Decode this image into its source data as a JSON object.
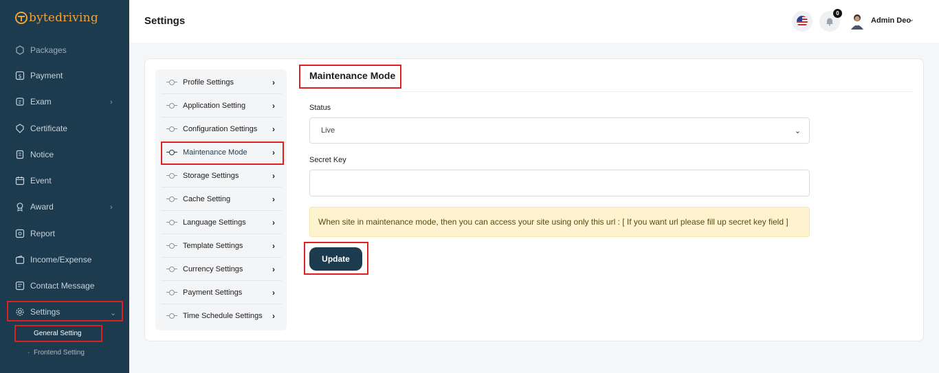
{
  "brand": {
    "name": "bytedriving"
  },
  "sidebar": {
    "partial_item": "Packages",
    "items": [
      {
        "label": "Payment",
        "icon": "dollar-icon"
      },
      {
        "label": "Exam",
        "icon": "exam-icon",
        "has_children": true
      },
      {
        "label": "Certificate",
        "icon": "certificate-icon"
      },
      {
        "label": "Notice",
        "icon": "notice-icon"
      },
      {
        "label": "Event",
        "icon": "calendar-icon"
      },
      {
        "label": "Award",
        "icon": "award-icon",
        "has_children": true
      },
      {
        "label": "Report",
        "icon": "report-icon"
      },
      {
        "label": "Income/Expense",
        "icon": "wallet-icon"
      },
      {
        "label": "Contact Message",
        "icon": "message-icon"
      },
      {
        "label": "Settings",
        "icon": "gear-icon",
        "expanded": true
      }
    ],
    "sub_items": [
      {
        "label": "General Setting",
        "active": true
      },
      {
        "label": "Frontend Setting"
      }
    ]
  },
  "header": {
    "title": "Settings",
    "notification_count": "0",
    "user_name": "Admin Deo"
  },
  "settings_menu": {
    "items": [
      {
        "label": "Profile Settings"
      },
      {
        "label": "Application Setting"
      },
      {
        "label": "Configuration Settings"
      },
      {
        "label": "Maintenance Mode",
        "active": true
      },
      {
        "label": "Storage Settings"
      },
      {
        "label": "Cache Setting"
      },
      {
        "label": "Language Settings"
      },
      {
        "label": "Template Settings"
      },
      {
        "label": "Currency Settings"
      },
      {
        "label": "Payment Settings"
      },
      {
        "label": "Time Schedule Settings"
      }
    ]
  },
  "form": {
    "title": "Maintenance Mode",
    "status_label": "Status",
    "status_value": "Live",
    "secret_key_label": "Secret Key",
    "secret_key_value": "",
    "notice": "When site in maintenance mode, then you can access your site using only this url : [ If you want url please fill up secret key field ]",
    "submit_label": "Update"
  },
  "colors": {
    "sidebar_bg": "#1d3b4e",
    "brand_orange": "#f2a23a",
    "highlight_red": "#e02020",
    "alert_bg": "#fdf3cf"
  }
}
